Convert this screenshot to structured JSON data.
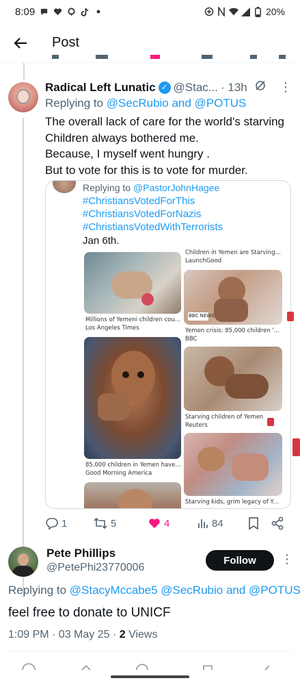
{
  "status_bar": {
    "time": "8:09",
    "battery": "20%"
  },
  "header": {
    "title": "Post"
  },
  "tweet": {
    "author_name": "Radical Left Lunatic",
    "handle": "@Stac...",
    "time": "· 13h",
    "replying_prefix": "Replying to ",
    "replying_links": "@SecRubio and @POTUS",
    "body_lines": [
      "The overall lack of care for the world's starving",
      "Children always bothered me.",
      "Because, I myself went hungry .",
      "But to vote for this is to vote for murder."
    ],
    "quote": {
      "replying_prefix": "Replying to ",
      "replying_link": "@PastorJohnHagee",
      "hashtags": [
        "#ChristiansVotedForThis",
        "#ChristiansVotedForNazis",
        "#ChristiansVotedWithTerrorists"
      ],
      "date": "Jan 6th.",
      "images": [
        {
          "title": "",
          "source": ""
        },
        {
          "title": "Children in Yemen are Starving |...",
          "source": "LaunchGood"
        },
        {
          "title": "Millions of Yemeni children coul...",
          "source": "Los Angeles Times"
        },
        {
          "title": "Yemen crisis: 85,000 children '...",
          "source": "BBC"
        },
        {
          "title": "Starving children of Yemen",
          "source": "Reuters"
        },
        {
          "title": "85,000 children in Yemen have ...",
          "source": "Good Morning America"
        },
        {
          "title": "Starving kids, grim legacy of Ye...",
          "source": ""
        }
      ],
      "bbc_badge": "BBC NEWS"
    },
    "stats": {
      "replies": "1",
      "reposts": "5",
      "likes": "4",
      "views": "84"
    }
  },
  "reply": {
    "author_name": "Pete Phillips",
    "handle": "@PetePhi23770006",
    "follow_label": "Follow",
    "replying_prefix": "Replying to ",
    "replying_links": "@StacyMccabe5 @SecRubio and @POTUS",
    "body": "feel free to donate to UNICF",
    "meta_time": "1:09 PM · 03 May 25 · ",
    "views_count": "2",
    "views_label": " Views"
  },
  "colors": {
    "accent": "#1d9bf0",
    "like": "#f91880",
    "text": "#0f1419",
    "muted": "#536471"
  }
}
